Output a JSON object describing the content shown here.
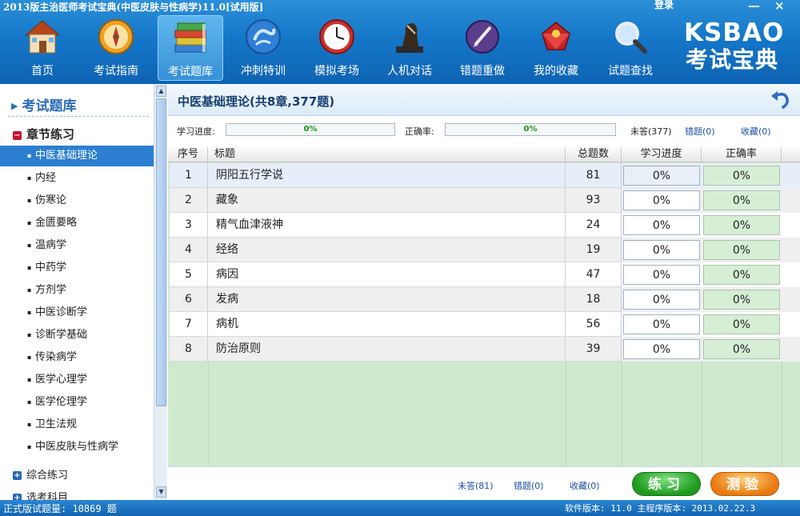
{
  "window": {
    "title": "2013版主治医师考试宝典(中医皮肤与性病学)11.0[试用版]",
    "login": "登录",
    "minimize": "—",
    "close": "×"
  },
  "nav": [
    {
      "label": "首页",
      "icon": "house-icon"
    },
    {
      "label": "考试指南",
      "icon": "compass-icon"
    },
    {
      "label": "考试题库",
      "icon": "books-icon",
      "active": true
    },
    {
      "label": "冲刺特训",
      "icon": "runner-icon"
    },
    {
      "label": "模拟考场",
      "icon": "clock-icon"
    },
    {
      "label": "人机对话",
      "icon": "chess-icon"
    },
    {
      "label": "错题重做",
      "icon": "pen-icon"
    },
    {
      "label": "我的收藏",
      "icon": "treasure-icon"
    },
    {
      "label": "试题查找",
      "icon": "magnifier-icon"
    }
  ],
  "logo": {
    "brand": "KSBAO",
    "sub": "考试宝典"
  },
  "sidebar": {
    "title": "考试题库",
    "chapter_group": "章节练习",
    "items": [
      "中医基础理论",
      "内经",
      "伤寒论",
      "金匮要略",
      "温病学",
      "中药学",
      "方剂学",
      "中医诊断学",
      "诊断学基础",
      "传染病学",
      "医学心理学",
      "医学伦理学",
      "卫生法规",
      "中医皮肤与性病学"
    ],
    "selected_index": 0,
    "group2": "综合练习",
    "group3": "选考科目"
  },
  "main": {
    "title": "中医基础理论(共8章,377题)",
    "progress_label": "学习进度:",
    "progress_value": "0%",
    "accuracy_label": "正确率:",
    "accuracy_value": "0%",
    "unanswered": "未答(377)",
    "wrong": "错题(0)",
    "favorites": "收藏(0)"
  },
  "table": {
    "headers": [
      "序号",
      "标题",
      "总题数",
      "学习进度",
      "正确率"
    ],
    "rows": [
      {
        "no": "1",
        "title": "阴阳五行学说",
        "total": "81",
        "progress": "0%",
        "accuracy": "0%"
      },
      {
        "no": "2",
        "title": "藏象",
        "total": "93",
        "progress": "0%",
        "accuracy": "0%"
      },
      {
        "no": "3",
        "title": "精气血津液神",
        "total": "24",
        "progress": "0%",
        "accuracy": "0%"
      },
      {
        "no": "4",
        "title": "经络",
        "total": "19",
        "progress": "0%",
        "accuracy": "0%"
      },
      {
        "no": "5",
        "title": "病因",
        "total": "47",
        "progress": "0%",
        "accuracy": "0%"
      },
      {
        "no": "6",
        "title": "发病",
        "total": "18",
        "progress": "0%",
        "accuracy": "0%"
      },
      {
        "no": "7",
        "title": "病机",
        "total": "56",
        "progress": "0%",
        "accuracy": "0%"
      },
      {
        "no": "8",
        "title": "防治原则",
        "total": "39",
        "progress": "0%",
        "accuracy": "0%"
      }
    ]
  },
  "bottom": {
    "unanswered": "未答(81)",
    "wrong": "错题(0)",
    "favorites": "收藏(0)",
    "practice": "练习",
    "test": "测验"
  },
  "status": {
    "left": "正式版试题量: 10869 题",
    "right": "软件版本: 11.0 主程序版本: 2013.02.22.3"
  },
  "colors": {
    "title_bar": "#1577c8",
    "sidebar_selected": "#2c7fd0",
    "table_bg_green": "#cfe9cf",
    "practice_button": "#1e9a1e",
    "test_button": "#e97a10"
  }
}
